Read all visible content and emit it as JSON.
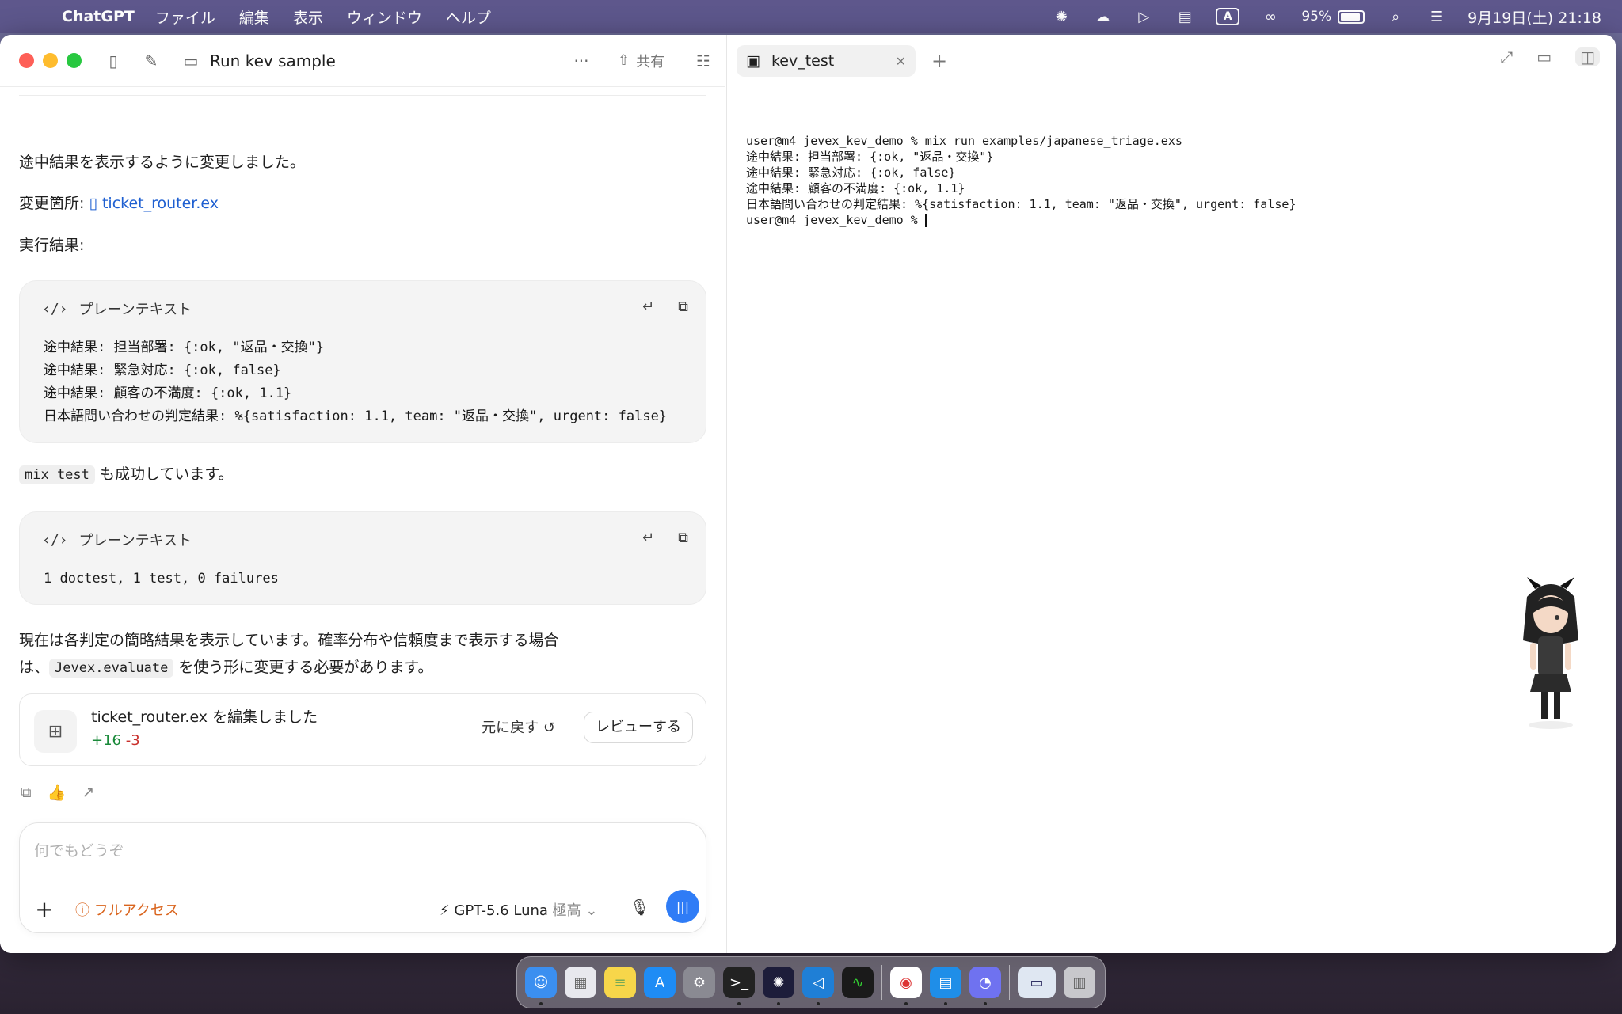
{
  "menubar": {
    "app_name": "ChatGPT",
    "menus": [
      "ファイル",
      "編集",
      "表示",
      "ウィンドウ",
      "ヘルプ"
    ],
    "battery": "95%",
    "datetime": "9月19日(土) 21:18",
    "input_mode": "A"
  },
  "chat_window": {
    "title": "Run kev sample",
    "share_label": "共有",
    "intro": "途中結果を表示するように変更しました。",
    "changed_label": "変更箇所:",
    "changed_file": "ticket_router.ex",
    "result_label": "実行結果:",
    "code_block_1": {
      "lang": "プレーンテキスト",
      "lines": [
        "途中結果: 担当部署: {:ok, \"返品・交換\"}",
        "途中結果: 緊急対応: {:ok, false}",
        "途中結果: 顧客の不満度: {:ok, 1.1}",
        "日本語問い合わせの判定結果: %{satisfaction: 1.1, team: \"返品・交換\", urgent: false}"
      ]
    },
    "mix_test_code": "mix test",
    "mix_test_text": "も成功しています。",
    "code_block_2": {
      "lang": "プレーンテキスト",
      "lines": [
        "1 doctest, 1 test, 0 failures"
      ]
    },
    "summary_line_1": "現在は各判定の簡略結果を表示しています。確率分布や信頼度まで表示する場合",
    "summary_prefix": "は、",
    "summary_code": "Jevex.evaluate",
    "summary_suffix": "を使う形に変更する必要があります。",
    "edit_card": {
      "file": "ticket_router.ex",
      "action": "を編集しました",
      "added": "+16",
      "removed": "-3",
      "undo_label": "元に戻す",
      "review_label": "レビューする"
    },
    "composer": {
      "placeholder": "何でもどうぞ",
      "access_label": "フルアクセス",
      "model": "GPT-5.6 Luna",
      "effort": "極高"
    }
  },
  "terminal": {
    "tab_title": "kev_test",
    "lines": [
      "user@m4 jevex_kev_demo % mix run examples/japanese_triage.exs",
      "途中結果: 担当部署: {:ok, \"返品・交換\"}",
      "途中結果: 緊急対応: {:ok, false}",
      "途中結果: 顧客の不満度: {:ok, 1.1}",
      "日本語問い合わせの判定結果: %{satisfaction: 1.1, team: \"返品・交換\", urgent: false}"
    ],
    "prompt": "user@m4 jevex_kev_demo % "
  },
  "colors": {
    "link": "#1e5fd1",
    "added": "#1a8a3a",
    "removed": "#c9302c",
    "access": "#d9641d",
    "voice_button": "#2f7cf6"
  },
  "dock": {
    "apps": [
      "finder-icon",
      "launchpad-icon",
      "notes-icon",
      "app-store-icon",
      "system-settings-icon",
      "terminal-icon",
      "chatgpt-icon",
      "vscode-icon",
      "activity-monitor-icon",
      "chrome-icon",
      "docker-icon",
      "messenger-icon",
      "preview-icon",
      "trash-icon"
    ]
  }
}
